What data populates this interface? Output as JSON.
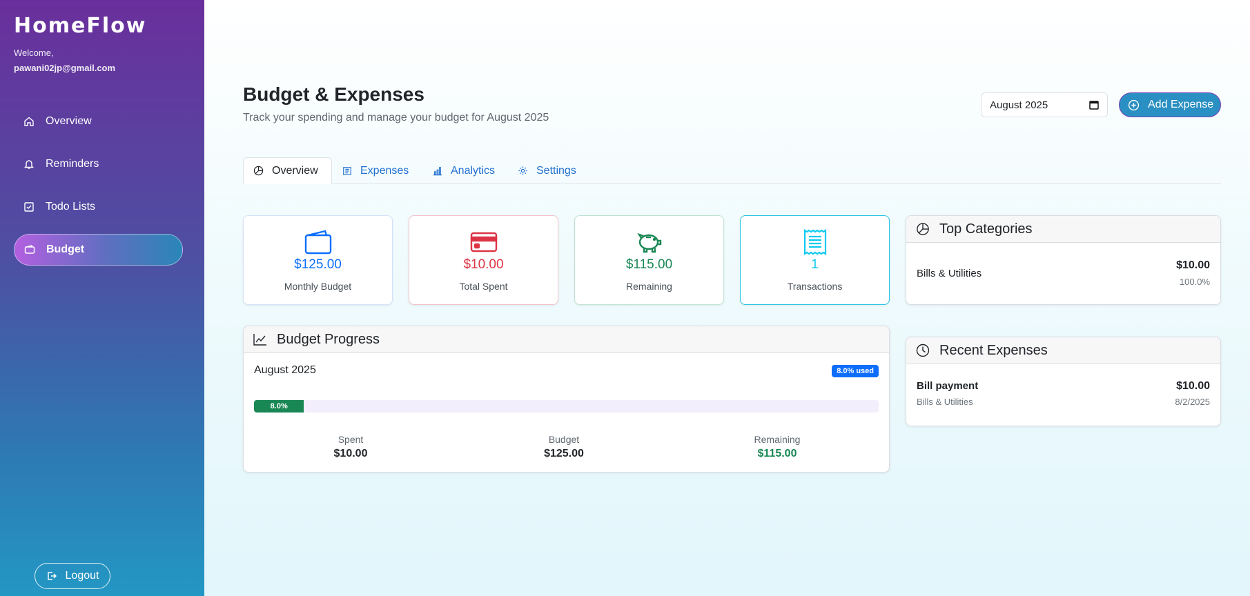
{
  "sidebar": {
    "brand": "HomeFlow",
    "welcome": "Welcome,",
    "email": "pawani02jp@gmail.com",
    "items": [
      {
        "label": "Overview",
        "icon": "home-icon"
      },
      {
        "label": "Reminders",
        "icon": "bell-icon"
      },
      {
        "label": "Todo Lists",
        "icon": "checkbox-icon"
      },
      {
        "label": "Budget",
        "icon": "wallet-icon",
        "active": true
      }
    ],
    "logout": "Logout"
  },
  "header": {
    "title": "Budget & Expenses",
    "subtitle": "Track your spending and manage your budget for August 2025",
    "month_value": "August 2025",
    "add_label": "Add Expense"
  },
  "tabs": [
    {
      "label": "Overview",
      "icon": "pie-chart-icon",
      "active": true
    },
    {
      "label": "Expenses",
      "icon": "receipt-icon"
    },
    {
      "label": "Analytics",
      "icon": "bar-chart-icon"
    },
    {
      "label": "Settings",
      "icon": "gear-icon"
    }
  ],
  "stats": [
    {
      "value": "$125.00",
      "label": "Monthly Budget",
      "color": "#0d6efd",
      "icon": "wallet-icon"
    },
    {
      "value": "$10.00",
      "label": "Total Spent",
      "color": "#dc3545",
      "icon": "credit-card-icon"
    },
    {
      "value": "$115.00",
      "label": "Remaining",
      "color": "#198754",
      "icon": "piggy-bank-icon"
    },
    {
      "value": "1",
      "label": "Transactions",
      "color": "#0dcaf0",
      "icon": "receipt-icon"
    }
  ],
  "budget_progress": {
    "title": "Budget Progress",
    "month": "August 2025",
    "badge": "8.0% used",
    "percent_label": "8.0%",
    "percent": 8.0,
    "spent_label": "Spent",
    "spent": "$10.00",
    "budget_label": "Budget",
    "budget": "$125.00",
    "remaining_label": "Remaining",
    "remaining": "$115.00"
  },
  "top_categories": {
    "title": "Top Categories",
    "items": [
      {
        "name": "Bills & Utilities",
        "amount": "$10.00",
        "percent": "100.0%"
      }
    ]
  },
  "recent_expenses": {
    "title": "Recent Expenses",
    "items": [
      {
        "name": "Bill payment",
        "category": "Bills & Utilities",
        "amount": "$10.00",
        "date": "8/2/2025"
      }
    ]
  }
}
